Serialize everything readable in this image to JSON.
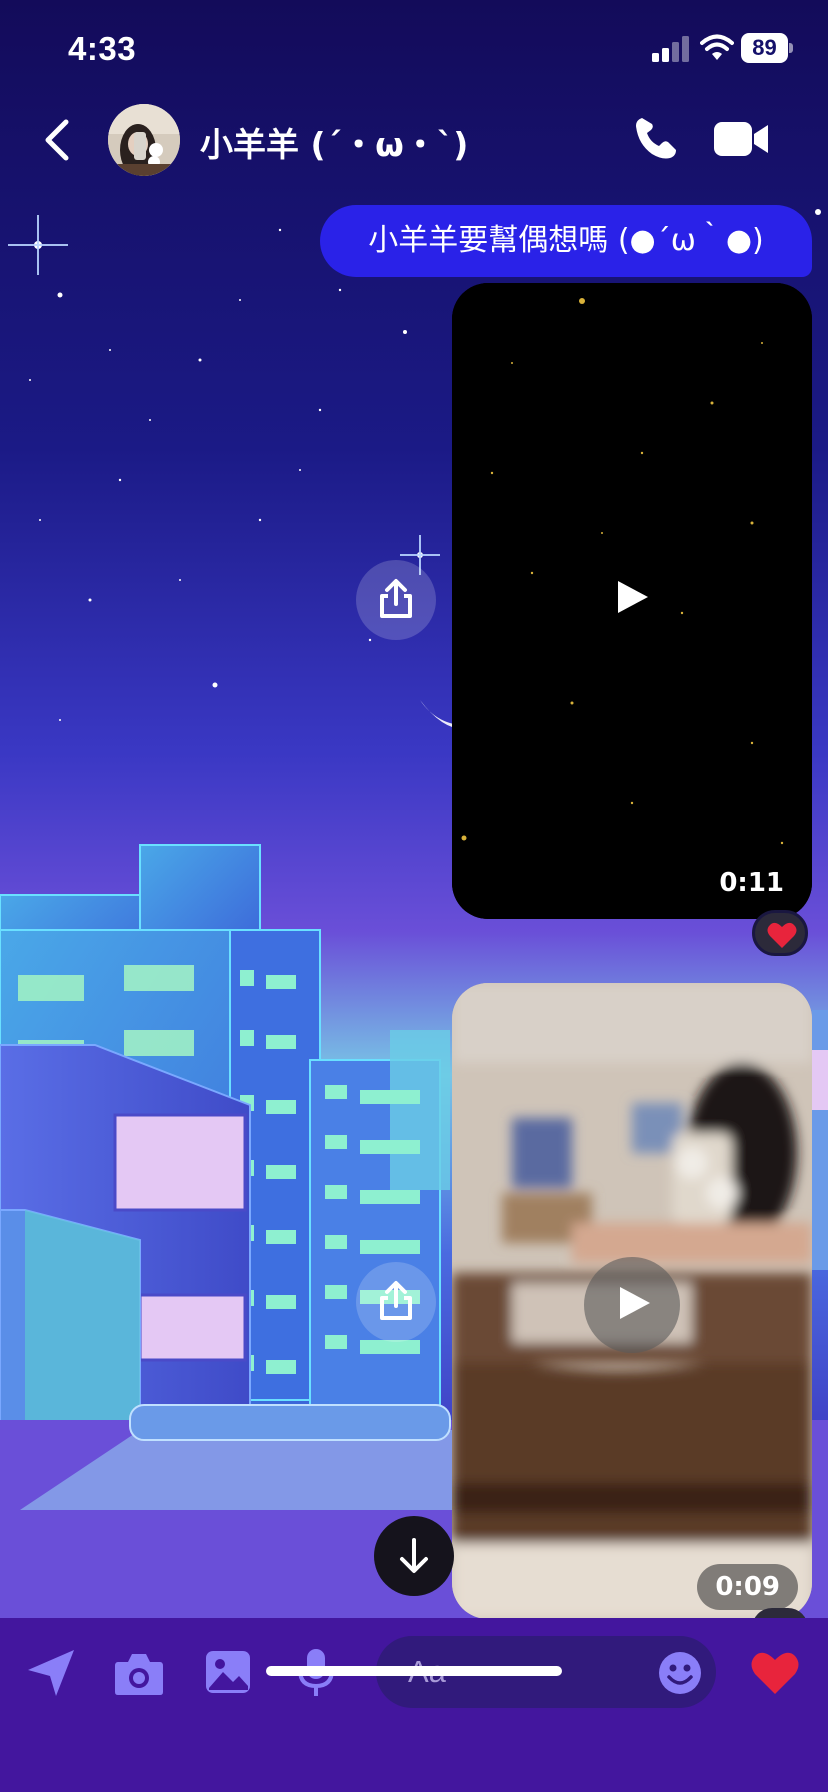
{
  "status_bar": {
    "time": "4:33",
    "battery": "89"
  },
  "header": {
    "contact_name": "小羊羊 (´・ω・`)"
  },
  "messages": [
    {
      "type": "text",
      "text": "小羊羊要幫偶想嗎 (●´ω｀●)"
    },
    {
      "type": "video",
      "duration": "0:11",
      "reaction": "heart"
    },
    {
      "type": "video",
      "duration": "0:09"
    }
  ],
  "composer": {
    "placeholder": "Aa"
  },
  "colors": {
    "accent": "#2a22e8",
    "composer_bg": "#43169e",
    "heart": "#e8243c"
  }
}
